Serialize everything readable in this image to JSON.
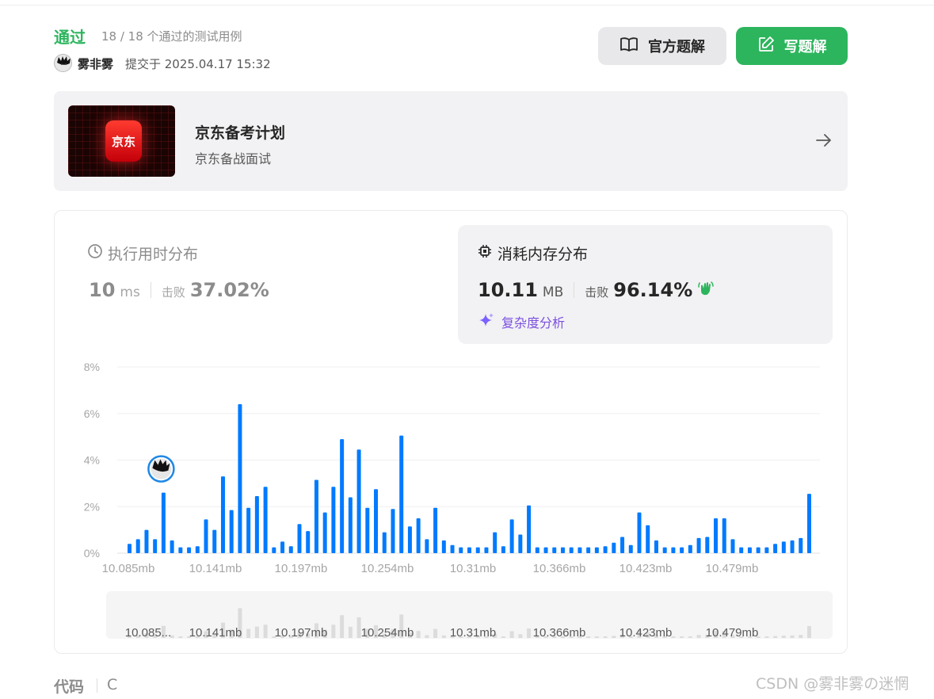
{
  "result": {
    "status": "通过",
    "cases": "18 / 18 个通过的测试用例",
    "username": "雾非雾",
    "submitted": "提交于 2025.04.17 15:32"
  },
  "buttons": {
    "official_solution": "官方题解",
    "write_solution": "写题解"
  },
  "promo": {
    "logo_text": "京东",
    "title": "京东备考计划",
    "subtitle": "京东备战面试"
  },
  "runtime": {
    "title": "执行用时分布",
    "value": "10",
    "unit": "ms",
    "beat_label": "击败",
    "beat_value": "37.02%"
  },
  "memory": {
    "title": "消耗内存分布",
    "value": "10.11",
    "unit": "MB",
    "beat_label": "击败",
    "beat_value": "96.14%",
    "analysis_link": "复杂度分析"
  },
  "chart_data": {
    "type": "bar",
    "ylim": [
      0,
      8
    ],
    "y_ticks": [
      "0%",
      "2%",
      "4%",
      "6%",
      "8%"
    ],
    "x_tick_labels": [
      "10.085mb",
      "10.141mb",
      "10.197mb",
      "10.254mb",
      "10.31mb",
      "10.366mb",
      "10.423mb",
      "10.479mb"
    ],
    "navigator_labels": [
      "10.085...",
      "10.141mb",
      "10.197mb",
      "10.254mb",
      "10.31mb",
      "10.366mb",
      "10.423mb",
      "10.479mb"
    ],
    "bar_color": "#007aff",
    "highlight_index": 4,
    "values": [
      0.4,
      0.6,
      1.0,
      0.6,
      2.6,
      0.55,
      0.25,
      0.25,
      0.3,
      1.45,
      1.0,
      3.3,
      1.85,
      6.4,
      1.95,
      2.45,
      2.85,
      0.25,
      0.5,
      0.3,
      1.25,
      0.95,
      3.15,
      1.75,
      2.85,
      4.9,
      2.4,
      4.45,
      1.95,
      2.75,
      0.9,
      1.9,
      5.05,
      1.15,
      1.5,
      0.6,
      1.95,
      0.55,
      0.35,
      0.25,
      0.25,
      0.25,
      0.25,
      0.9,
      0.3,
      1.45,
      0.8,
      2.05,
      0.25,
      0.25,
      0.25,
      0.25,
      0.25,
      0.25,
      0.25,
      0.25,
      0.3,
      0.45,
      0.7,
      0.35,
      1.75,
      1.2,
      0.55,
      0.25,
      0.25,
      0.25,
      0.35,
      0.65,
      0.7,
      1.5,
      1.5,
      0.6,
      0.25,
      0.25,
      0.25,
      0.25,
      0.4,
      0.5,
      0.55,
      0.65,
      2.55
    ]
  },
  "code": {
    "label": "代码",
    "language": "C"
  },
  "watermark": "CSDN @雾非雾の迷惘"
}
